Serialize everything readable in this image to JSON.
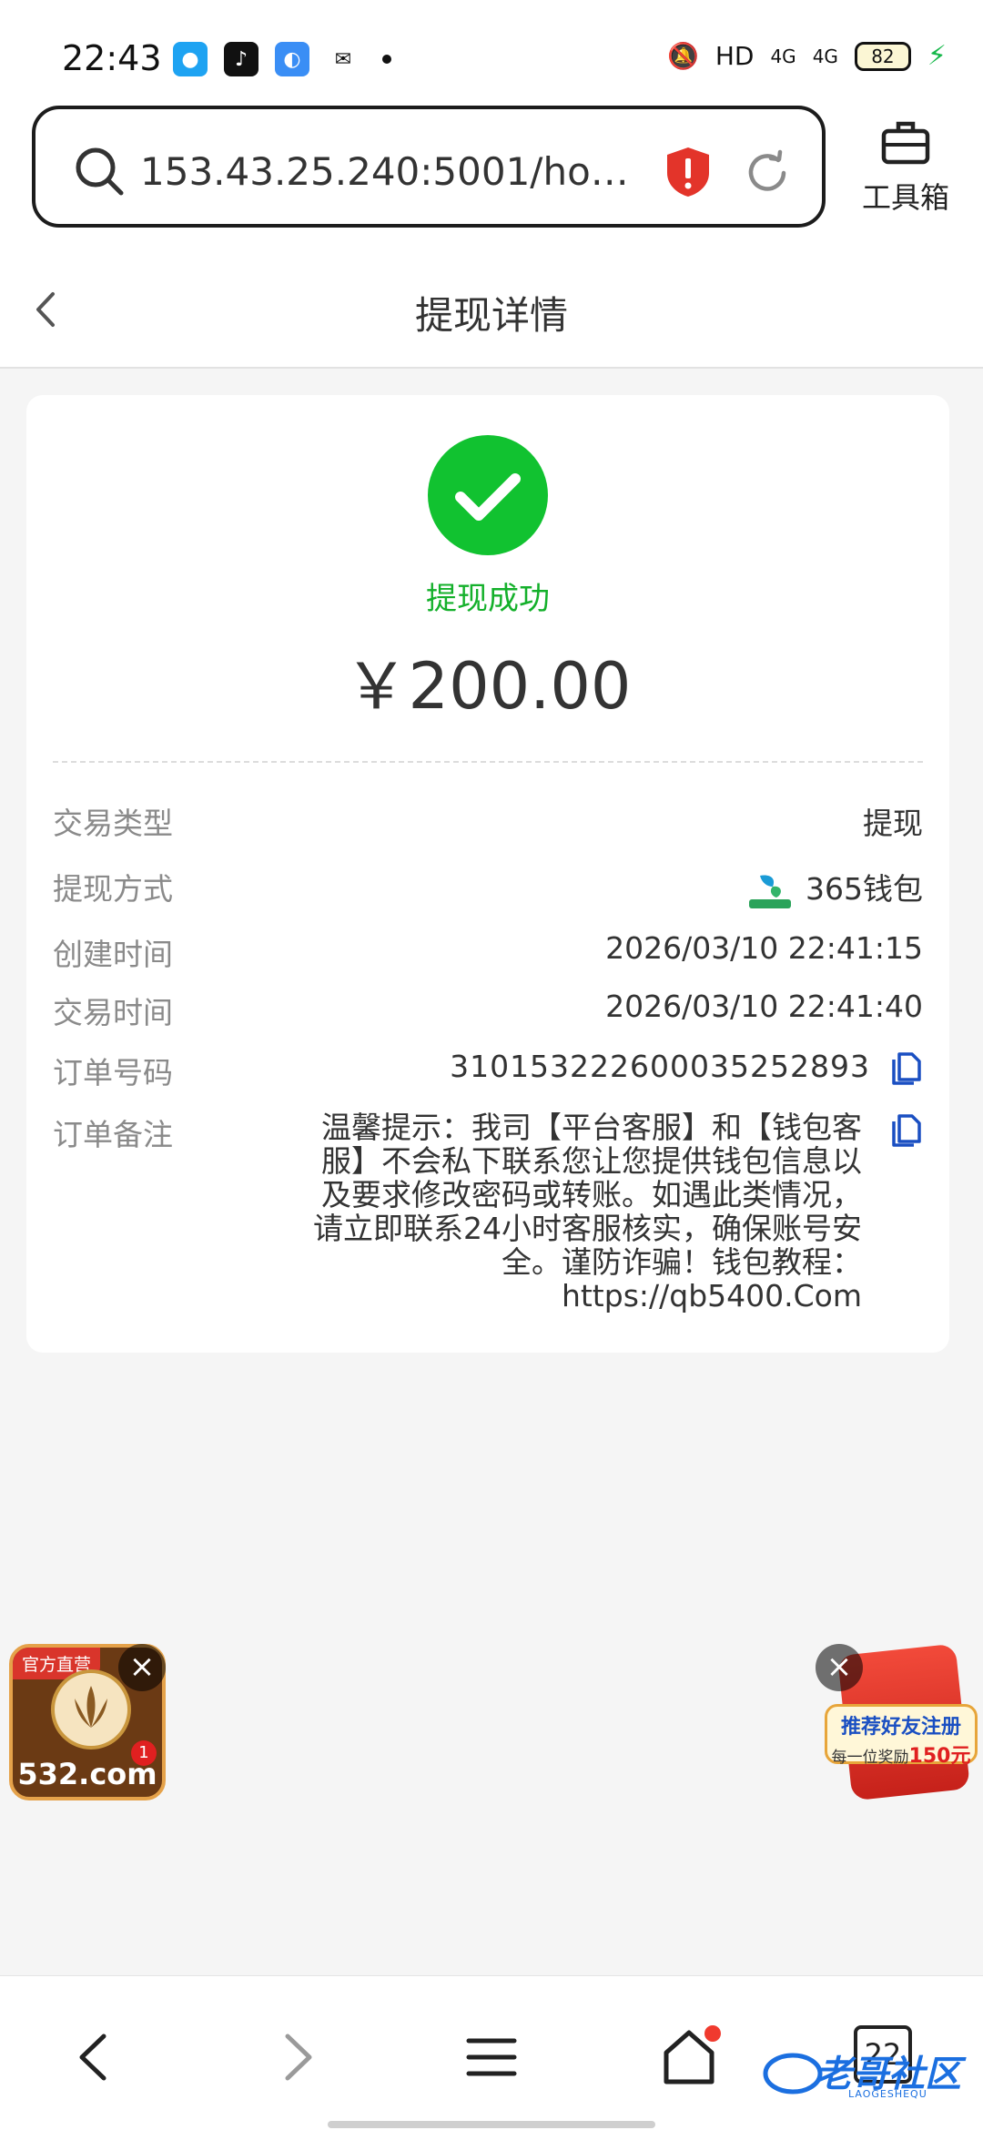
{
  "status_bar": {
    "time": "22:43",
    "network": "HD",
    "signal1": "4G",
    "signal2": "4G",
    "battery": "82"
  },
  "browser": {
    "url": "153.43.25.240:5001/hom...",
    "toolbox_label": "工具箱"
  },
  "page": {
    "title": "提现详情"
  },
  "detail": {
    "status_text": "提现成功",
    "amount": "￥200.00",
    "rows": [
      {
        "label": "交易类型",
        "value": "提现"
      },
      {
        "label": "提现方式",
        "value": "365钱包",
        "logo_text": "365钱包"
      },
      {
        "label": "创建时间",
        "value": "2026/03/10 22:41:15"
      },
      {
        "label": "交易时间",
        "value": "2026/03/10 22:41:40"
      },
      {
        "label": "订单号码",
        "value": "310153222600035252893"
      },
      {
        "label": "订单备注",
        "value": "温馨提示：我司【平台客服】和【钱包客服】不会私下联系您让您提供钱包信息以及要求修改密码或转账。如遇此类情况，请立即联系24小时客服核实，确保账号安全。谨防诈骗！钱包教程：https://qb5400.Com"
      }
    ]
  },
  "ads": {
    "left_tag": "官方直营",
    "left_site": "532.com",
    "left_badge": "1",
    "right_line1": "推荐好友注册",
    "right_line2": "每一位奖励",
    "right_amount": "150元"
  },
  "nav": {
    "tabs_count": "22",
    "watermark": "老哥社区",
    "watermark_sub": "LAOGESHEQU"
  },
  "colors": {
    "success": "#11c230",
    "success_text": "#14b02b",
    "shield": "#e3342a",
    "link_blue": "#1a4fc2"
  }
}
